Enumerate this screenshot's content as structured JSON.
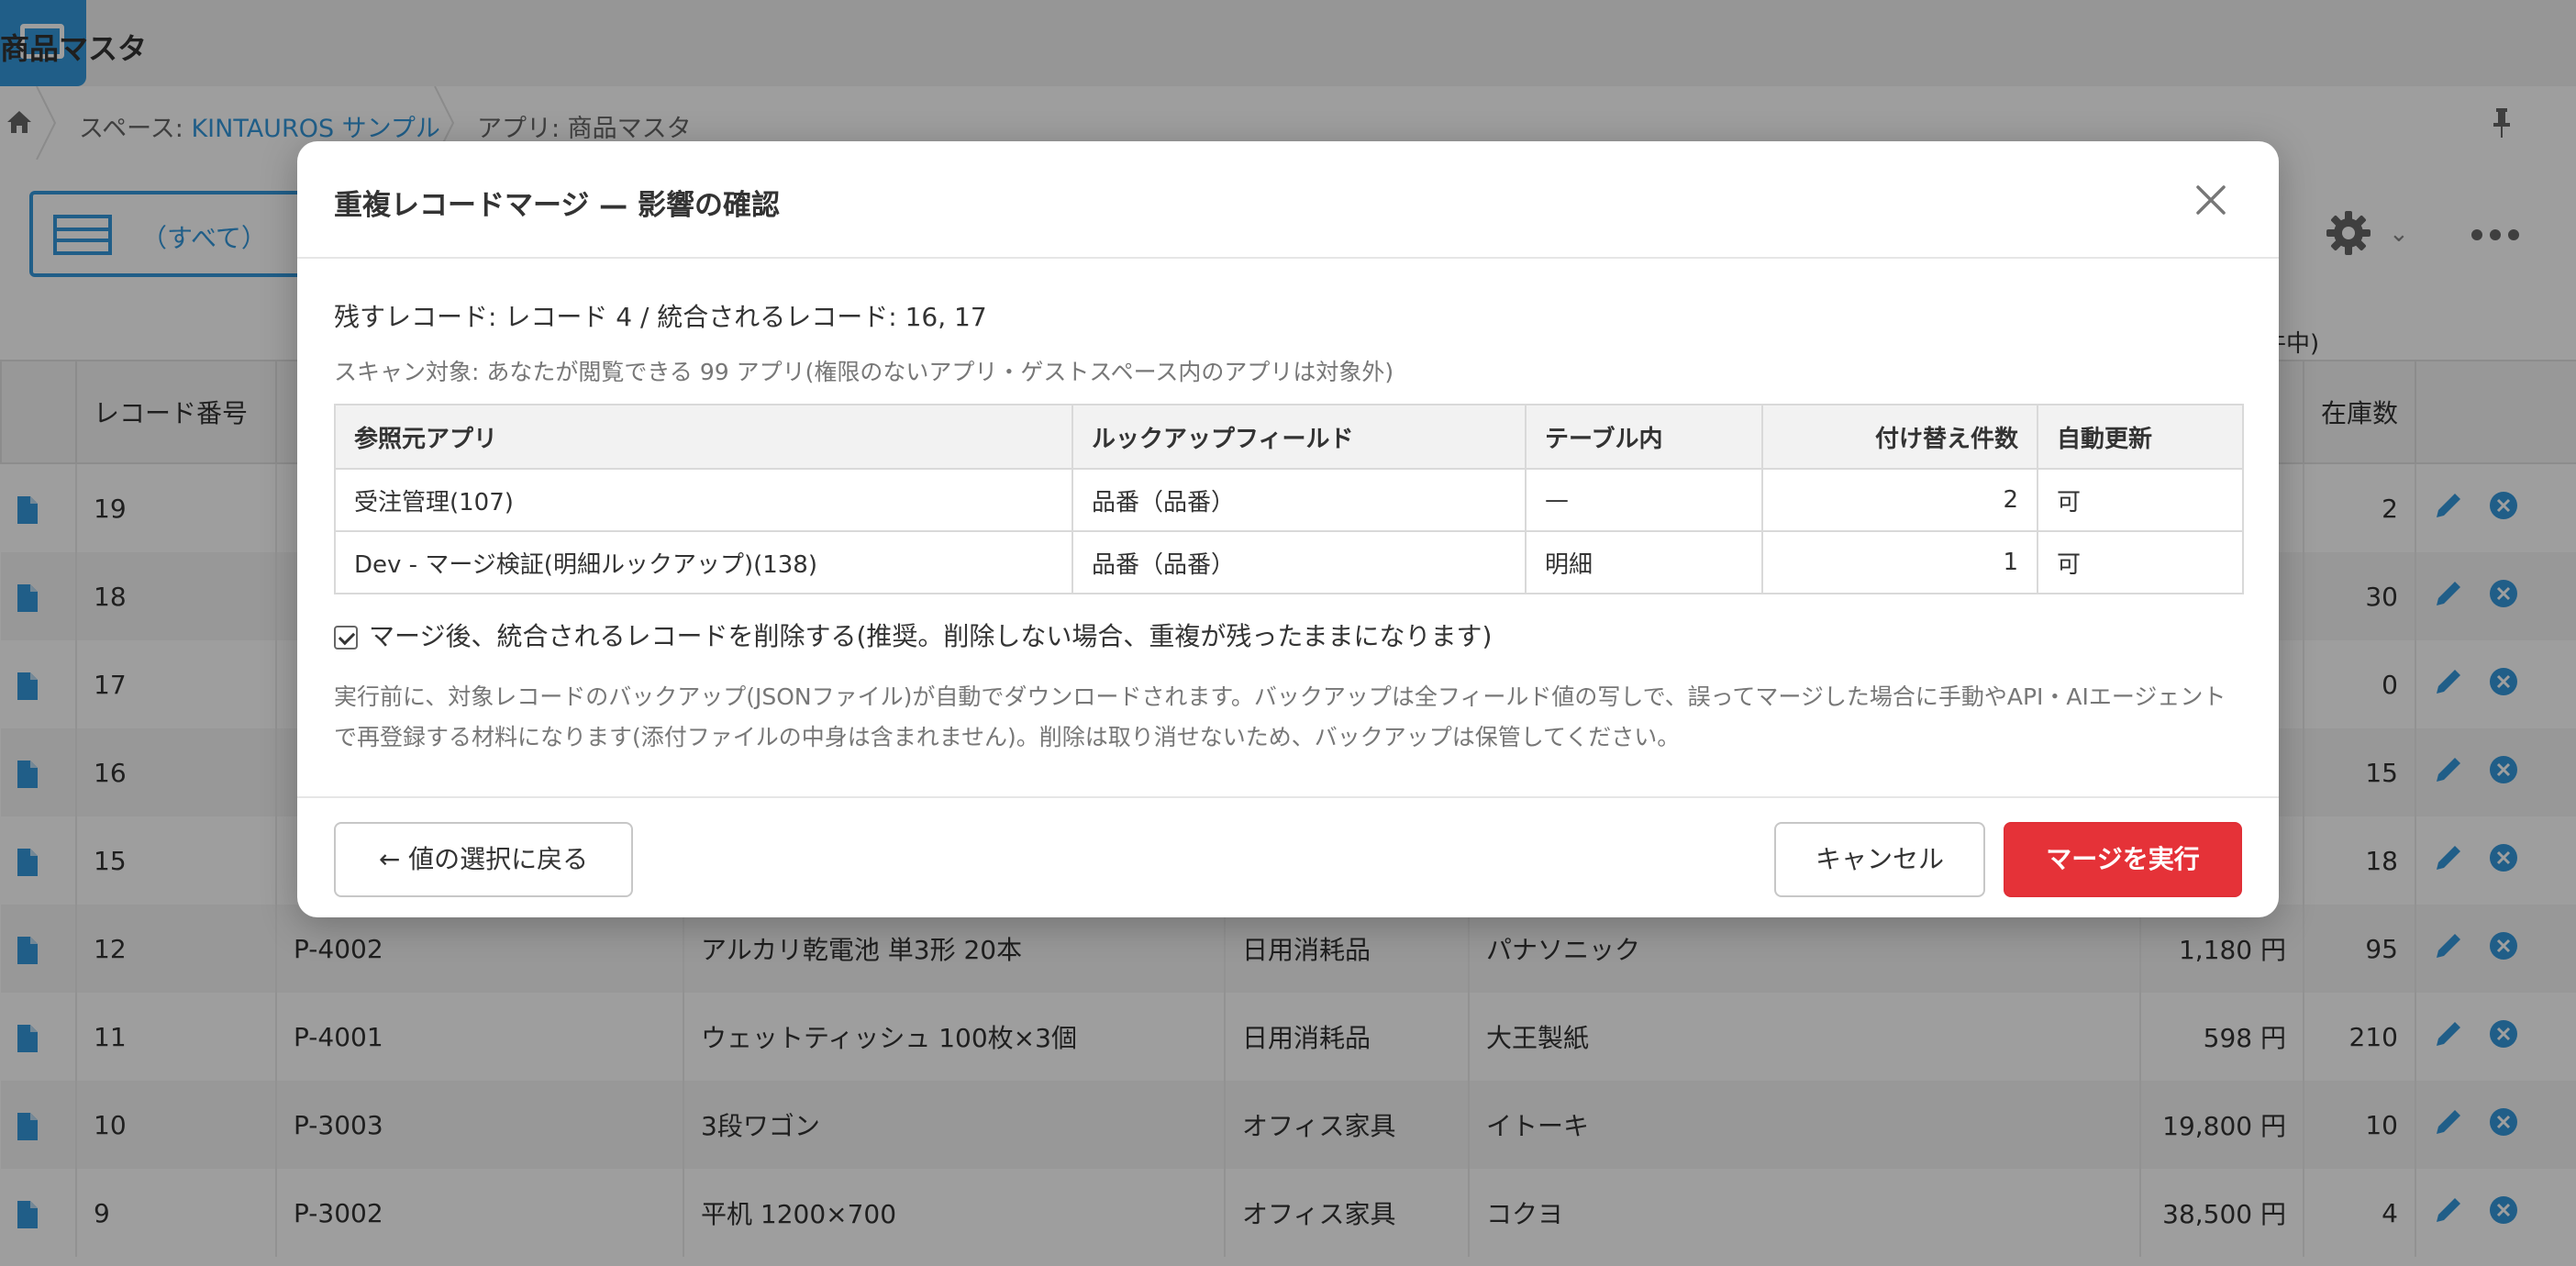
{
  "app": {
    "title": "商品マスタ"
  },
  "breadcrumb": {
    "space_prefix": "スペース: ",
    "space_name": "KINTAUROS サンプル",
    "app_label": "アプリ: 商品マスタ"
  },
  "toolbar": {
    "view_label": "（すべて）",
    "count_suffix": "件中)"
  },
  "grid": {
    "headers": {
      "record_no": "レコード番号",
      "stock": "在庫数"
    },
    "rows": [
      {
        "no": "19",
        "stock": "2"
      },
      {
        "no": "18",
        "stock": "30"
      },
      {
        "no": "17",
        "stock": "0"
      },
      {
        "no": "16",
        "stock": "15"
      },
      {
        "no": "15",
        "stock": "18"
      },
      {
        "no": "12",
        "code": "P-4002",
        "name": "アルカリ乾電池 単3形 20本",
        "category": "日用消耗品",
        "maker": "パナソニック",
        "price": "1,180 円",
        "stock": "95"
      },
      {
        "no": "11",
        "code": "P-4001",
        "name": "ウェットティッシュ 100枚×3個",
        "category": "日用消耗品",
        "maker": "大王製紙",
        "price": "598 円",
        "stock": "210"
      },
      {
        "no": "10",
        "code": "P-3003",
        "name": "3段ワゴン",
        "category": "オフィス家具",
        "maker": "イトーキ",
        "price": "19,800 円",
        "stock": "10"
      },
      {
        "no": "9",
        "code": "P-3002",
        "name": "平机 1200×700",
        "category": "オフィス家具",
        "maker": "コクヨ",
        "price": "38,500 円",
        "stock": "4"
      }
    ]
  },
  "dialog": {
    "title": "重複レコードマージ — 影響の確認",
    "summary": "残すレコード: レコード 4 / 統合されるレコード: 16, 17",
    "scan": "スキャン対象: あなたが閲覧できる 99 アプリ(権限のないアプリ・ゲストスペース内のアプリは対象外)",
    "table": {
      "headers": [
        "参照元アプリ",
        "ルックアップフィールド",
        "テーブル内",
        "付け替え件数",
        "自動更新"
      ],
      "rows": [
        [
          "受注管理(107)",
          "品番（品番）",
          "—",
          "2",
          "可"
        ],
        [
          "Dev - マージ検証(明細ルックアップ)(138)",
          "品番（品番）",
          "明細",
          "1",
          "可"
        ]
      ]
    },
    "delete_option": {
      "checked": true,
      "label": "マージ後、統合されるレコードを削除する(推奨。削除しない場合、重複が残ったままになります)"
    },
    "note_line1": "実行前に、対象レコードのバックアップ(JSONファイル)が自動でダウンロードされます。バックアップは全フィールド値の写しで、誤ってマージした場合に手動やAPI・AIエージェント",
    "note_line2": "で再登録する材料になります(添付ファイルの中身は含まれません)。削除は取り消せないため、バックアップは保管してください。",
    "buttons": {
      "back": "← 値の選択に戻る",
      "cancel": "キャンセル",
      "execute": "マージを実行"
    }
  },
  "colors": {
    "accent": "#3498db",
    "danger": "#e53238"
  }
}
